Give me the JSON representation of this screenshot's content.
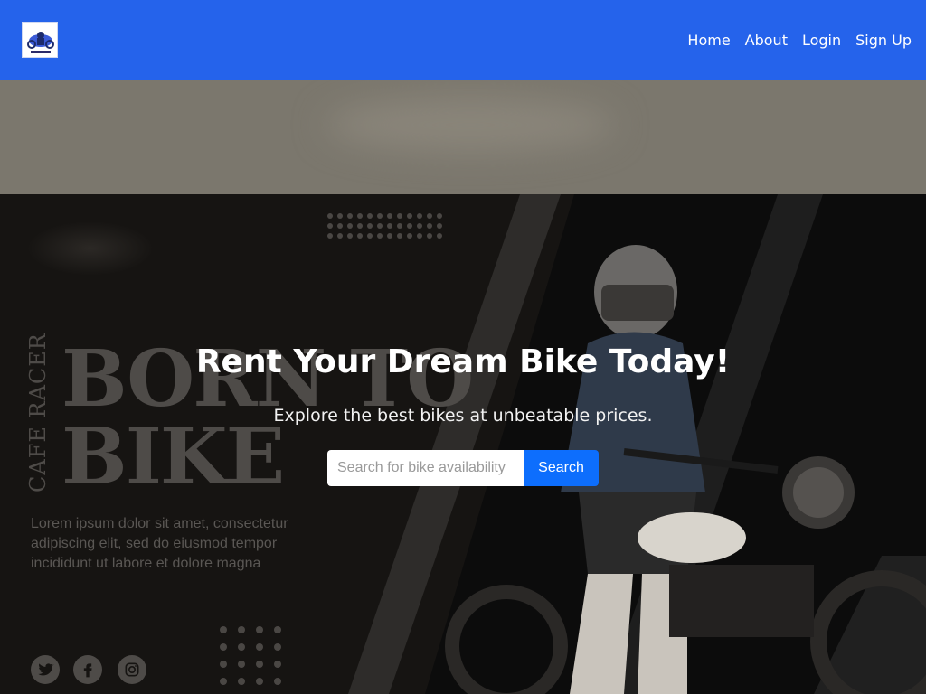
{
  "nav": {
    "logo_icon": "bike-rental-logo",
    "links": [
      "Home",
      "About",
      "Login",
      "Sign Up"
    ]
  },
  "hero": {
    "title": "Rent Your Dream Bike Today!",
    "subtitle": "Explore the best bikes at unbeatable prices.",
    "search": {
      "placeholder": "Search for bike availability",
      "button_label": "Search"
    }
  },
  "banner": {
    "side_text": "CAFE RACER",
    "headline_line1": "BORN TO",
    "headline_line2": "BIKE",
    "body": "Lorem ipsum dolor sit amet, consectetur adipiscing elit, sed do eiusmod tempor incididunt ut labore et dolore magna",
    "social_icons": [
      "twitter-icon",
      "facebook-icon",
      "instagram-icon"
    ]
  },
  "colors": {
    "nav_bg": "#2563eb",
    "button_bg": "#0d6efd",
    "hero_bg": "#161412"
  }
}
